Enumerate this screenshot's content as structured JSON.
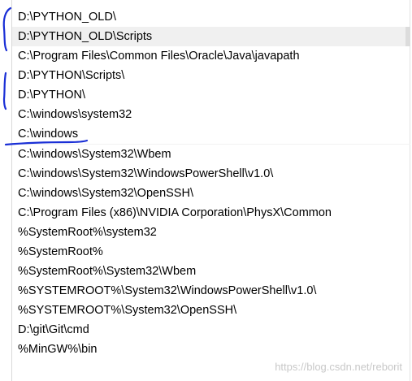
{
  "path_list": {
    "entries": [
      "D:\\PYTHON_OLD\\",
      "D:\\PYTHON_OLD\\Scripts",
      "C:\\Program Files\\Common Files\\Oracle\\Java\\javapath",
      "D:\\PYTHON\\Scripts\\",
      "D:\\PYTHON\\",
      "C:\\windows\\system32",
      "C:\\windows",
      "C:\\windows\\System32\\Wbem",
      "C:\\windows\\System32\\WindowsPowerShell\\v1.0\\",
      "C:\\windows\\System32\\OpenSSH\\",
      "C:\\Program Files (x86)\\NVIDIA Corporation\\PhysX\\Common",
      "%SystemRoot%\\system32",
      "%SystemRoot%",
      "%SystemRoot%\\System32\\Wbem",
      "%SYSTEMROOT%\\System32\\WindowsPowerShell\\v1.0\\",
      "%SYSTEMROOT%\\System32\\OpenSSH\\",
      "D:\\git\\Git\\cmd",
      "%MinGW%\\bin"
    ],
    "selected_index": 1
  },
  "annotation_color": "#1a2fd6",
  "watermark": "https://blog.csdn.net/reborit"
}
